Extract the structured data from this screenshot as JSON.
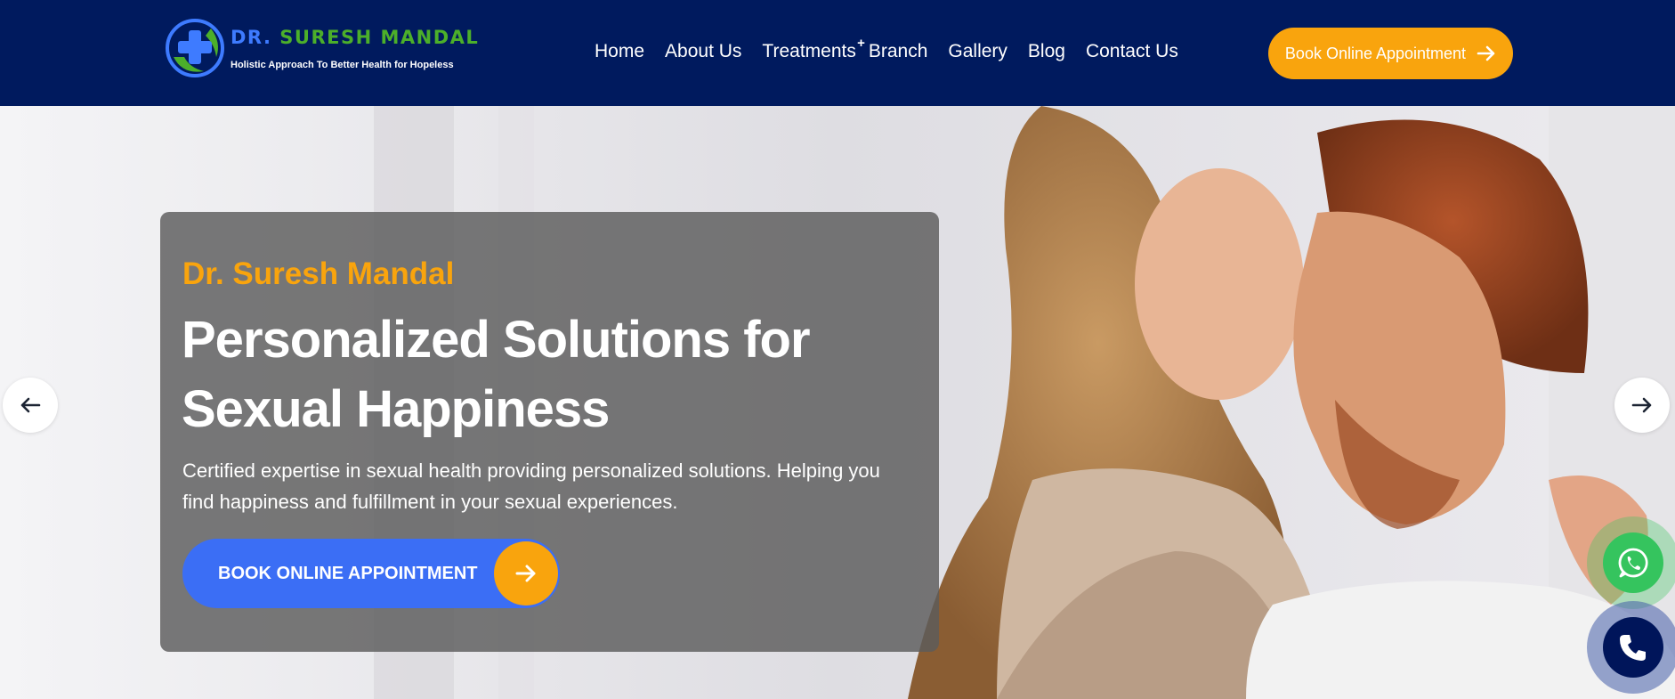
{
  "brand": {
    "name_first": "DR.",
    "name_rest": "SURESH MANDAL",
    "tagline": "Holistic Approach To Better Health for Hopeless",
    "colors": {
      "navy": "#001a5e",
      "accent": "#f9a40d",
      "blue": "#3b6ef5",
      "green": "#4caf2a"
    }
  },
  "nav": {
    "items": [
      {
        "label": "Home"
      },
      {
        "label": "About Us"
      },
      {
        "label": "Treatments",
        "expand_marker": "+"
      },
      {
        "label": "Branch"
      },
      {
        "label": "Gallery"
      },
      {
        "label": "Blog"
      },
      {
        "label": "Contact Us"
      }
    ],
    "cta_label": "Book Online Appointment",
    "cta_icon": "arrow-right-icon"
  },
  "hero": {
    "eyebrow": "Dr. Suresh Mandal",
    "title": "Personalized Solutions for Sexual Happiness",
    "description": "Certified expertise in sexual health providing personalized solutions. Helping you find happiness and fulfillment in your sexual experiences.",
    "cta_label": "BOOK ONLINE APPOINTMENT",
    "cta_icon": "arrow-right-icon"
  },
  "slider": {
    "prev_icon": "arrow-left-icon",
    "next_icon": "arrow-right-icon"
  },
  "floating": {
    "whatsapp_icon": "whatsapp-icon",
    "phone_icon": "phone-icon"
  }
}
